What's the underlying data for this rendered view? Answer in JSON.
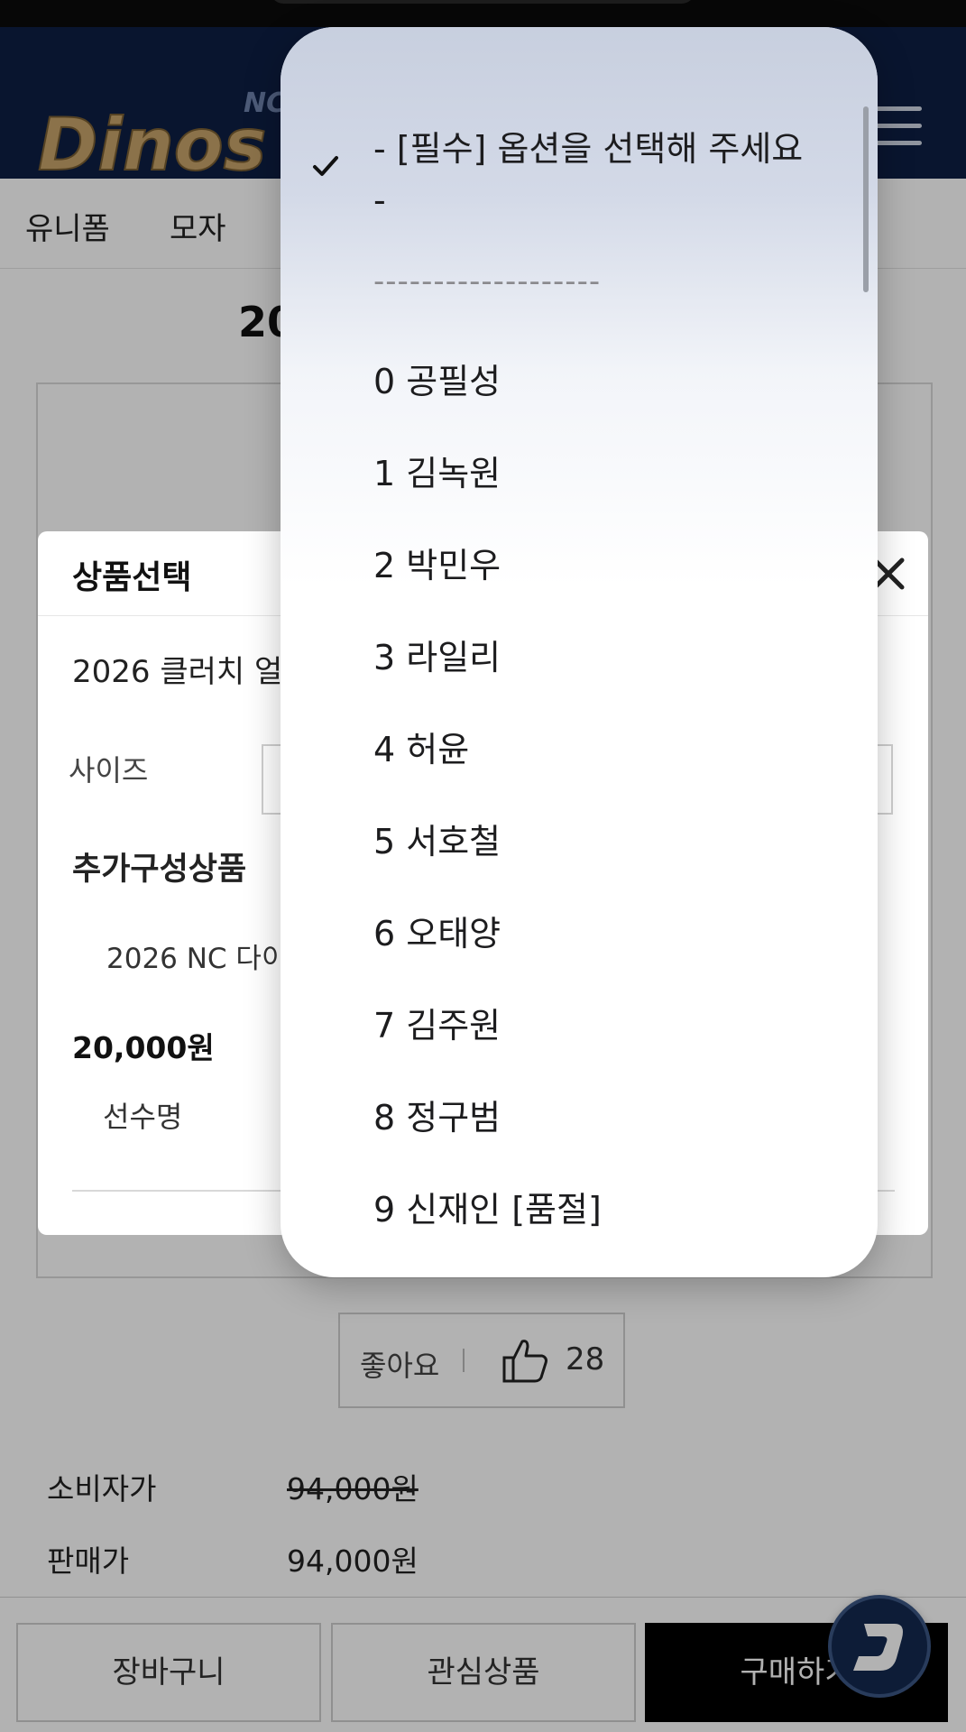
{
  "header": {
    "logo_text": "Dinos",
    "logo_badge": "NC"
  },
  "categories": [
    "유니폼",
    "모자"
  ],
  "product": {
    "title_fragment": "20"
  },
  "like": {
    "label": "좋아요",
    "count": "28"
  },
  "prices": {
    "consumer_label": "소비자가",
    "consumer_value": "94,000원",
    "sale_label": "판매가",
    "sale_value": "94,000원"
  },
  "bottom_bar": {
    "cart_label": "장바구니",
    "wishlist_label": "관심상품",
    "buy_label": "구매하기"
  },
  "modal": {
    "title": "상품선택",
    "product_name": "2026 클러치 얼",
    "size_label": "사이즈",
    "addon_title": "추가구성상품",
    "addon_name": "2026 NC 다이",
    "addon_price": "20,000원",
    "player_label": "선수명"
  },
  "picker": {
    "selected_index": 0,
    "options": [
      "- [필수] 옵션을 선택해 주세요",
      "-",
      "-------------------",
      "0 공필성",
      "1 김녹원",
      "2 박민우",
      "3 라일리",
      "4 허윤",
      "5 서호철",
      "6 오태양",
      "7 김주원",
      "8 정구범",
      "9 신재인 [품절]"
    ]
  },
  "colors": {
    "header_navy": "#0d1f44",
    "logo_gold": "#c8a46a",
    "buy_button": "#000000",
    "fab_navy": "#14294f"
  }
}
